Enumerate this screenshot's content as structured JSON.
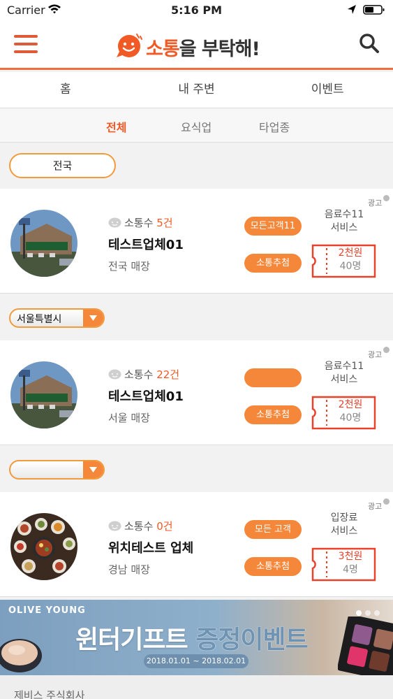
{
  "status": {
    "carrier": "Carrier",
    "time": "5:16 PM"
  },
  "header": {
    "logo_prefix": "소통",
    "logo_particle": "을",
    "logo_suffix": " 부탁해!"
  },
  "main_tabs": [
    "홈",
    "내 주변",
    "이벤트"
  ],
  "sub_tabs": {
    "items": [
      "전체",
      "요식업",
      "타업종"
    ],
    "active": "전체"
  },
  "region_filter": "전국",
  "cards": [
    {
      "talk_label": "소통수",
      "talk_count": "5건",
      "name": "테스트업체01",
      "area": "전국 매장",
      "pill_top": "모든고객11",
      "pill_bottom": "소통추첨",
      "ad": "광고",
      "service_line1": "음료수11",
      "service_line2": "서비스",
      "coupon_price": "2천원",
      "coupon_count": "40명",
      "image": "storefront-photo"
    },
    {
      "talk_label": "소통수",
      "talk_count": "22건",
      "name": "테스트업체01",
      "area": "서울 매장",
      "pill_top": "",
      "pill_bottom": "소통추첨",
      "ad": "광고",
      "service_line1": "음료수11",
      "service_line2": "서비스",
      "coupon_price": "2천원",
      "coupon_count": "40명",
      "image": "storefront-photo"
    },
    {
      "talk_label": "소통수",
      "talk_count": "0건",
      "name": "위치테스트 업체",
      "area": "경남 매장",
      "pill_top": "모든 고객",
      "pill_bottom": "소통추첨",
      "ad": "광고",
      "service_line1": "입장료",
      "service_line2": "서비스",
      "coupon_price": "3천원",
      "coupon_count": "4명",
      "image": "korean-food-photo"
    }
  ],
  "filters": [
    "서울특별시",
    ""
  ],
  "banner": {
    "brand": "OLIVE YOUNG",
    "headline_main": "윈터기프트 ",
    "headline_accent": "증정이벤트",
    "dates": "2018.01.01 ~ 2018.02.01",
    "slide_count": 3,
    "active_slide": 1
  },
  "footer": {
    "company": "제비스 주식회사"
  },
  "colors": {
    "accent": "#f15a24",
    "pill": "#f5873a",
    "coupon": "#e8422c"
  }
}
